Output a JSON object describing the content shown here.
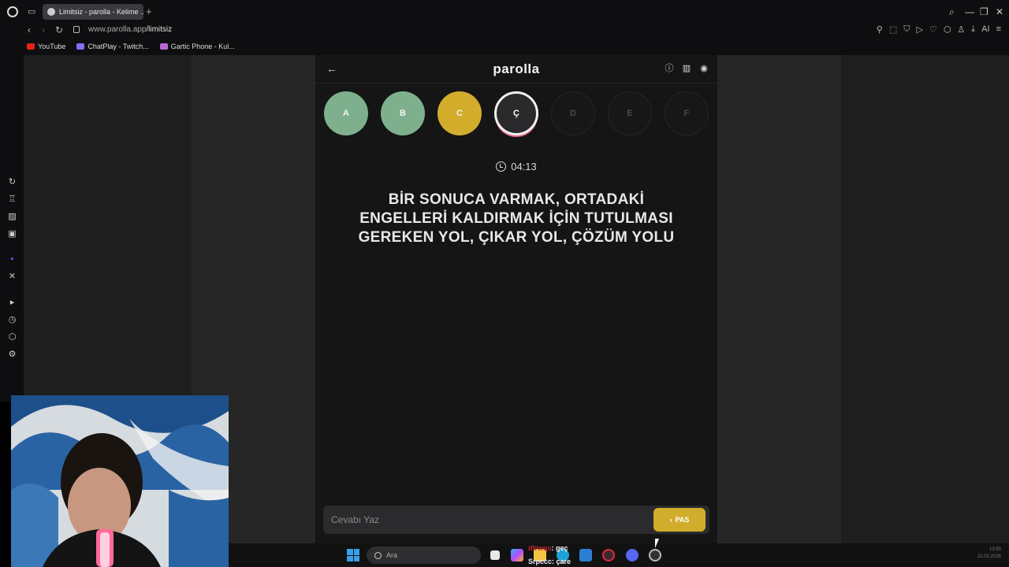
{
  "browser": {
    "tab_title": "Limitsiz - parolla - Kelime ...",
    "url_host": "www.parolla.app",
    "url_path": "/limitsiz",
    "aria_label": "AI",
    "bookmarks": [
      {
        "label": "YouTube",
        "icon": "youtube-icon",
        "color": "#e62117"
      },
      {
        "label": "ChatPlay - Twitch...",
        "icon": "chatplay-icon",
        "color": "#8a6cf0"
      },
      {
        "label": "Gartic Phone - Kul...",
        "icon": "gartic-icon",
        "color": "#b967d8"
      }
    ]
  },
  "game": {
    "logo": "parolla",
    "timer": "04:13",
    "question": "BİR SONUCA VARMAK, ORTADAKİ ENGELLERİ KALDIRMAK İÇİN TUTULMASI GEREKEN YOL, ÇIKAR YOL, ÇÖZÜM YOLU",
    "letters": [
      {
        "letter": "A",
        "state": "correct"
      },
      {
        "letter": "B",
        "state": "correct"
      },
      {
        "letter": "C",
        "state": "passed"
      },
      {
        "letter": "Ç",
        "state": "current"
      },
      {
        "letter": "D",
        "state": "pending"
      },
      {
        "letter": "E",
        "state": "pending"
      },
      {
        "letter": "F",
        "state": "pending"
      }
    ],
    "answer_placeholder": "Cevabı Yaz",
    "pass_label": "PAS"
  },
  "taskbar": {
    "search_placeholder": "Ara",
    "chat": [
      {
        "user": "dfrwqs",
        "message": ": geç"
      },
      {
        "user": "Srpccc",
        "message": ": çare"
      }
    ],
    "clock_time": "13:50",
    "clock_date": "21.02.2026"
  },
  "colors": {
    "correct": "#7fb08d",
    "passed": "#d2ad2c",
    "current_ring": "#e86a86",
    "panel": "#151516"
  }
}
